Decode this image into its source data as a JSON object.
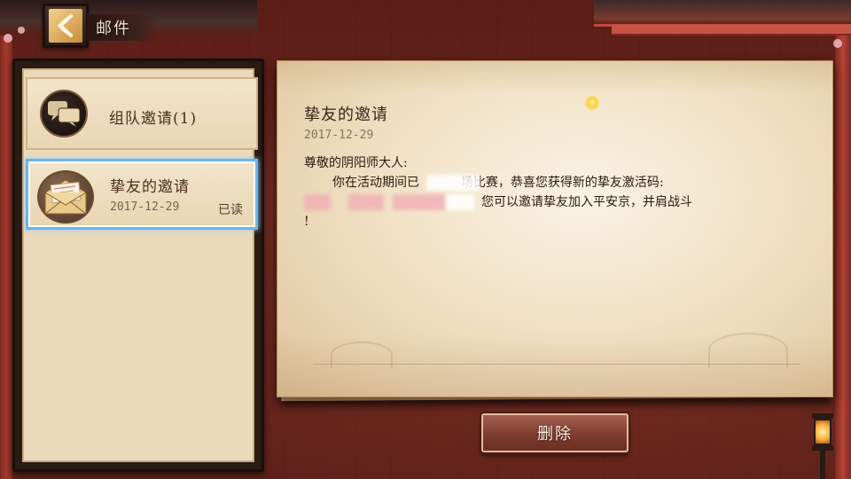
{
  "header": {
    "title": "邮件",
    "back_icon": "back-arrow-icon"
  },
  "mail_list": {
    "items": [
      {
        "title": "组队邀请(1)",
        "date": "",
        "status": "",
        "icon": "chat-bubbles-icon",
        "selected": false
      },
      {
        "title": "挚友的邀请",
        "date": "2017-12-29",
        "status": "已读",
        "icon": "open-envelope-icon",
        "selected": true
      }
    ]
  },
  "letter": {
    "title": "挚友的邀请",
    "date": "2017-12-29",
    "greeting": "尊敬的阴阳师大人:",
    "line2_start": "你在活动期间已",
    "line2_end": "场比赛，恭喜您获得新的挚友激活码:",
    "line3_text": "您可以邀请挚友加入平安京，并肩战斗",
    "line4_text": "!"
  },
  "actions": {
    "delete_label": "删除"
  },
  "colors": {
    "selection_border": "#6fb3ea",
    "button_bg": "#7f3d30",
    "paper": "#f1e2c6"
  }
}
